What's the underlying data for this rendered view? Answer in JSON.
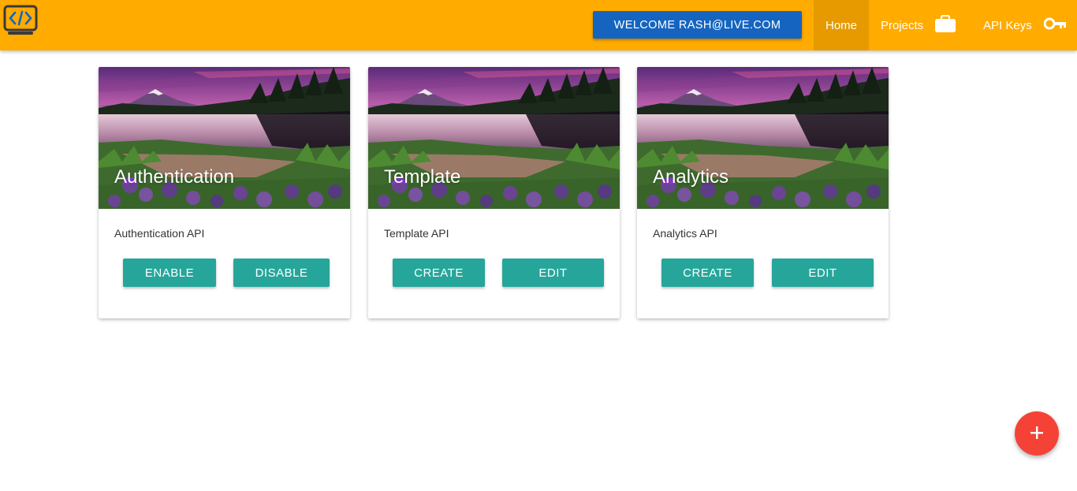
{
  "header": {
    "logo_icon": "code-monitor-icon",
    "welcome_label": "WELCOME RASH@LIVE.COM",
    "nav": [
      {
        "label": "Home",
        "icon": null,
        "active": true
      },
      {
        "label": "Projects",
        "icon": "briefcase-icon",
        "active": false
      },
      {
        "label": "API Keys",
        "icon": "key-icon",
        "active": false
      }
    ]
  },
  "cards": [
    {
      "title": "Authentication",
      "description": "Authentication API",
      "buttons": [
        "ENABLE",
        "DISABLE"
      ]
    },
    {
      "title": "Template",
      "description": "Template API",
      "buttons": [
        "CREATE",
        "EDIT"
      ]
    },
    {
      "title": "Analytics",
      "description": "Analytics API",
      "buttons": [
        "CREATE",
        "EDIT"
      ]
    }
  ],
  "fab": {
    "icon": "plus-icon"
  },
  "colors": {
    "navbar": "#ffab00",
    "nav_active": "#e69a00",
    "welcome_button": "#1565c0",
    "card_button": "#26a69a",
    "fab": "#f44336"
  }
}
